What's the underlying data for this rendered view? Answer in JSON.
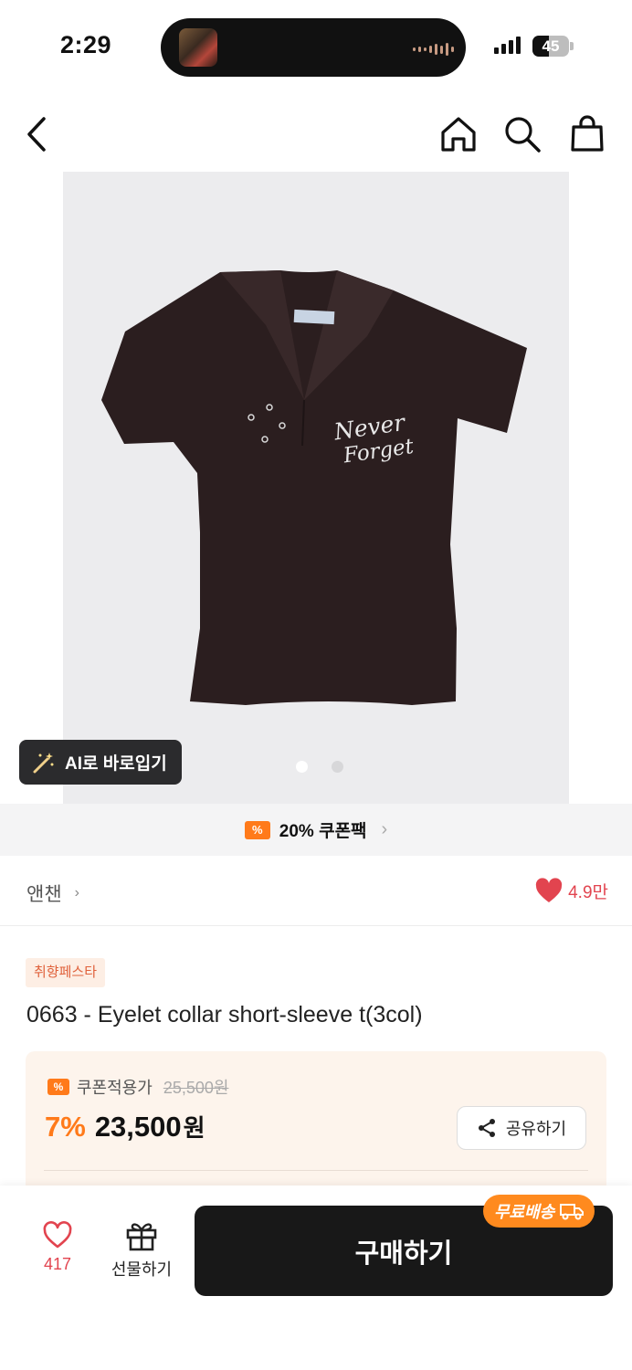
{
  "status_bar": {
    "time": "2:29",
    "battery_level": "45",
    "battery_fraction": 0.45
  },
  "nav": {
    "back_icon": "chevron-left-icon",
    "home_icon": "home-icon",
    "search_icon": "search-icon",
    "cart_icon": "shopping-bag-icon"
  },
  "gallery": {
    "ai_button_label": "AI로 바로입기",
    "ai_icon": "magic-wand-icon",
    "page_count": 2,
    "current_page": 1,
    "logo_text": "Never Forget"
  },
  "coupon_banner": {
    "label": "20% 쿠폰팩",
    "icon": "coupon-icon"
  },
  "brand": {
    "name": "앤챈",
    "likes": "4.9만",
    "like_color": "#e2444f"
  },
  "product": {
    "tag": "취향페스타",
    "title": "0663 - Eyelet collar short-sleeve t(3col)"
  },
  "price": {
    "coupon_label": "쿠폰적용가",
    "original_price": "25,500원",
    "discount": "7%",
    "final_price": "23,500",
    "currency": "원",
    "share_label": "공유하기",
    "accent_color": "#ff7a1a"
  },
  "bottom_bar": {
    "like_count": "417",
    "gift_label": "선물하기",
    "buy_label": "구매하기",
    "free_shipping_label": "무료배송"
  }
}
